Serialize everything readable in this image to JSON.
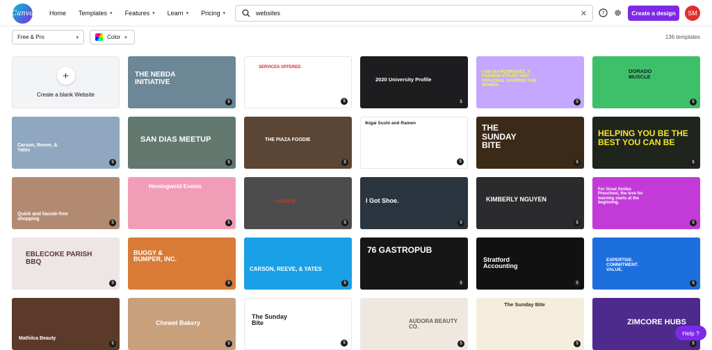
{
  "header": {
    "logo_text": "Canva",
    "nav": [
      {
        "label": "Home",
        "has_chevron": false
      },
      {
        "label": "Templates",
        "has_chevron": true
      },
      {
        "label": "Features",
        "has_chevron": true
      },
      {
        "label": "Learn",
        "has_chevron": true
      },
      {
        "label": "Pricing",
        "has_chevron": true
      }
    ],
    "search_value": "websites",
    "cta_label": "Create a design",
    "avatar_initials": "SM"
  },
  "filters": {
    "plan_label": "Free & Pro",
    "color_label": "Color",
    "template_count": "136 templates"
  },
  "grid": {
    "blank_label": "Create a blank Website",
    "templates": [
      {
        "title": "THE NEBDA INITIATIVE",
        "bg": "#6c8796",
        "fg": "#ffffff"
      },
      {
        "title": "SERVICES OFFERED",
        "bg": "#ffffff",
        "fg": "#d6262b"
      },
      {
        "title": "2020 University Profile",
        "bg": "#1d1d1f",
        "fg": "#ffffff"
      },
      {
        "title": "I AM GIA RODRIGUEZ. A FASHION STYLIST AND PERSONAL SHOPPER FOR WOMEN.",
        "bg": "#c4a7ff",
        "fg": "#e8ff3a"
      },
      {
        "title": "DORADO MUSCLE",
        "bg": "#3ec06b",
        "fg": "#1d1d1f"
      },
      {
        "title": "Carson, Reeve, & Yates",
        "bg": "#8fa8bf",
        "fg": "#ffffff"
      },
      {
        "title": "SAN DIAS MEETUP",
        "bg": "#63786f",
        "fg": "#ffffff"
      },
      {
        "title": "THE PIAZA FOODIE",
        "bg": "#5b4636",
        "fg": "#ffffff"
      },
      {
        "title": "Ikigai Sushi and Ramen",
        "bg": "#ffffff",
        "fg": "#1d1d1f"
      },
      {
        "title": "THE SUNDAY BITE",
        "bg": "#3b2a18",
        "fg": "#ffffff"
      },
      {
        "title": "HELPING YOU BE THE BEST YOU CAN BE",
        "bg": "#1f241d",
        "fg": "#f4e82a"
      },
      {
        "title": "Quick and hassle-free shopping",
        "bg": "#b28a72",
        "fg": "#ffffff"
      },
      {
        "title": "Hemingwold Events",
        "bg": "#f29db8",
        "fg": "#ffffff"
      },
      {
        "title": "savory",
        "bg": "#4c4c4c",
        "fg": "#c0392b"
      },
      {
        "title": "I Got Shoe.",
        "bg": "#2a3540",
        "fg": "#ffffff"
      },
      {
        "title": "KIMBERLY NGUYEN",
        "bg": "#2b2b2d",
        "fg": "#ffffff"
      },
      {
        "title": "For Great Smiles Preschool, the love for learning starts at the beginning.",
        "bg": "#c23bd9",
        "fg": "#ffffff"
      },
      {
        "title": "EBLECOKE PARISH BBQ",
        "bg": "#ede6e4",
        "fg": "#5a3535"
      },
      {
        "title": "BUGGY & BUMPER, INC.",
        "bg": "#d97b36",
        "fg": "#ffffff"
      },
      {
        "title": "CARSON, REEVE, & YATES",
        "bg": "#1aa0e6",
        "fg": "#ffffff"
      },
      {
        "title": "76 GASTROPUB",
        "bg": "#161616",
        "fg": "#ffffff"
      },
      {
        "title": "Stratford Accounting",
        "bg": "#111111",
        "fg": "#ffffff"
      },
      {
        "title": "EXPERTISE. COMMITMENT. VALUE.",
        "bg": "#1d6fe0",
        "fg": "#ffffff"
      },
      {
        "title": "Mathilca Beauty",
        "bg": "#5b3a2a",
        "fg": "#ffffff"
      },
      {
        "title": "Chewel Bakery",
        "bg": "#c8a07c",
        "fg": "#ffffff"
      },
      {
        "title": "The Sunday Bite",
        "bg": "#ffffff",
        "fg": "#1d1d1f"
      },
      {
        "title": "AUDORA BEAUTY CO.",
        "bg": "#efe8e1",
        "fg": "#6b5c52"
      },
      {
        "title": "The Sunday Bite",
        "bg": "#f5eedc",
        "fg": "#3a2a1a"
      },
      {
        "title": "ZIMCORE HUBS",
        "bg": "#4d2a8c",
        "fg": "#ffffff"
      }
    ]
  },
  "help_label": "Help ?"
}
